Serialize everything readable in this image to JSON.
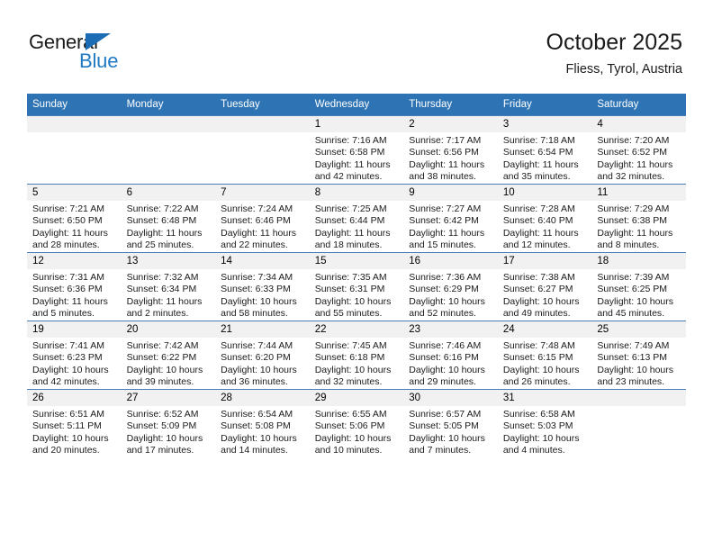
{
  "brand": {
    "line1": "General",
    "line2": "Blue",
    "triangle_color": "#1b6cb5",
    "text_color": "#1a1a1a",
    "accent_color": "#1f7ac4"
  },
  "header": {
    "title": "October 2025",
    "subtitle": "Fliess, Tyrol, Austria"
  },
  "theme": {
    "header_blue": "#2e74b5",
    "daynum_band": "#f1f1f1",
    "row_divider": "#4a7cb5",
    "text": "#1a1a1a"
  },
  "weekday_headers": [
    "Sunday",
    "Monday",
    "Tuesday",
    "Wednesday",
    "Thursday",
    "Friday",
    "Saturday"
  ],
  "weeks": [
    [
      {
        "day": "",
        "sunrise": "",
        "sunset": "",
        "daylight1": "",
        "daylight2": ""
      },
      {
        "day": "",
        "sunrise": "",
        "sunset": "",
        "daylight1": "",
        "daylight2": ""
      },
      {
        "day": "",
        "sunrise": "",
        "sunset": "",
        "daylight1": "",
        "daylight2": ""
      },
      {
        "day": "1",
        "sunrise": "Sunrise: 7:16 AM",
        "sunset": "Sunset: 6:58 PM",
        "daylight1": "Daylight: 11 hours",
        "daylight2": "and 42 minutes."
      },
      {
        "day": "2",
        "sunrise": "Sunrise: 7:17 AM",
        "sunset": "Sunset: 6:56 PM",
        "daylight1": "Daylight: 11 hours",
        "daylight2": "and 38 minutes."
      },
      {
        "day": "3",
        "sunrise": "Sunrise: 7:18 AM",
        "sunset": "Sunset: 6:54 PM",
        "daylight1": "Daylight: 11 hours",
        "daylight2": "and 35 minutes."
      },
      {
        "day": "4",
        "sunrise": "Sunrise: 7:20 AM",
        "sunset": "Sunset: 6:52 PM",
        "daylight1": "Daylight: 11 hours",
        "daylight2": "and 32 minutes."
      }
    ],
    [
      {
        "day": "5",
        "sunrise": "Sunrise: 7:21 AM",
        "sunset": "Sunset: 6:50 PM",
        "daylight1": "Daylight: 11 hours",
        "daylight2": "and 28 minutes."
      },
      {
        "day": "6",
        "sunrise": "Sunrise: 7:22 AM",
        "sunset": "Sunset: 6:48 PM",
        "daylight1": "Daylight: 11 hours",
        "daylight2": "and 25 minutes."
      },
      {
        "day": "7",
        "sunrise": "Sunrise: 7:24 AM",
        "sunset": "Sunset: 6:46 PM",
        "daylight1": "Daylight: 11 hours",
        "daylight2": "and 22 minutes."
      },
      {
        "day": "8",
        "sunrise": "Sunrise: 7:25 AM",
        "sunset": "Sunset: 6:44 PM",
        "daylight1": "Daylight: 11 hours",
        "daylight2": "and 18 minutes."
      },
      {
        "day": "9",
        "sunrise": "Sunrise: 7:27 AM",
        "sunset": "Sunset: 6:42 PM",
        "daylight1": "Daylight: 11 hours",
        "daylight2": "and 15 minutes."
      },
      {
        "day": "10",
        "sunrise": "Sunrise: 7:28 AM",
        "sunset": "Sunset: 6:40 PM",
        "daylight1": "Daylight: 11 hours",
        "daylight2": "and 12 minutes."
      },
      {
        "day": "11",
        "sunrise": "Sunrise: 7:29 AM",
        "sunset": "Sunset: 6:38 PM",
        "daylight1": "Daylight: 11 hours",
        "daylight2": "and 8 minutes."
      }
    ],
    [
      {
        "day": "12",
        "sunrise": "Sunrise: 7:31 AM",
        "sunset": "Sunset: 6:36 PM",
        "daylight1": "Daylight: 11 hours",
        "daylight2": "and 5 minutes."
      },
      {
        "day": "13",
        "sunrise": "Sunrise: 7:32 AM",
        "sunset": "Sunset: 6:34 PM",
        "daylight1": "Daylight: 11 hours",
        "daylight2": "and 2 minutes."
      },
      {
        "day": "14",
        "sunrise": "Sunrise: 7:34 AM",
        "sunset": "Sunset: 6:33 PM",
        "daylight1": "Daylight: 10 hours",
        "daylight2": "and 58 minutes."
      },
      {
        "day": "15",
        "sunrise": "Sunrise: 7:35 AM",
        "sunset": "Sunset: 6:31 PM",
        "daylight1": "Daylight: 10 hours",
        "daylight2": "and 55 minutes."
      },
      {
        "day": "16",
        "sunrise": "Sunrise: 7:36 AM",
        "sunset": "Sunset: 6:29 PM",
        "daylight1": "Daylight: 10 hours",
        "daylight2": "and 52 minutes."
      },
      {
        "day": "17",
        "sunrise": "Sunrise: 7:38 AM",
        "sunset": "Sunset: 6:27 PM",
        "daylight1": "Daylight: 10 hours",
        "daylight2": "and 49 minutes."
      },
      {
        "day": "18",
        "sunrise": "Sunrise: 7:39 AM",
        "sunset": "Sunset: 6:25 PM",
        "daylight1": "Daylight: 10 hours",
        "daylight2": "and 45 minutes."
      }
    ],
    [
      {
        "day": "19",
        "sunrise": "Sunrise: 7:41 AM",
        "sunset": "Sunset: 6:23 PM",
        "daylight1": "Daylight: 10 hours",
        "daylight2": "and 42 minutes."
      },
      {
        "day": "20",
        "sunrise": "Sunrise: 7:42 AM",
        "sunset": "Sunset: 6:22 PM",
        "daylight1": "Daylight: 10 hours",
        "daylight2": "and 39 minutes."
      },
      {
        "day": "21",
        "sunrise": "Sunrise: 7:44 AM",
        "sunset": "Sunset: 6:20 PM",
        "daylight1": "Daylight: 10 hours",
        "daylight2": "and 36 minutes."
      },
      {
        "day": "22",
        "sunrise": "Sunrise: 7:45 AM",
        "sunset": "Sunset: 6:18 PM",
        "daylight1": "Daylight: 10 hours",
        "daylight2": "and 32 minutes."
      },
      {
        "day": "23",
        "sunrise": "Sunrise: 7:46 AM",
        "sunset": "Sunset: 6:16 PM",
        "daylight1": "Daylight: 10 hours",
        "daylight2": "and 29 minutes."
      },
      {
        "day": "24",
        "sunrise": "Sunrise: 7:48 AM",
        "sunset": "Sunset: 6:15 PM",
        "daylight1": "Daylight: 10 hours",
        "daylight2": "and 26 minutes."
      },
      {
        "day": "25",
        "sunrise": "Sunrise: 7:49 AM",
        "sunset": "Sunset: 6:13 PM",
        "daylight1": "Daylight: 10 hours",
        "daylight2": "and 23 minutes."
      }
    ],
    [
      {
        "day": "26",
        "sunrise": "Sunrise: 6:51 AM",
        "sunset": "Sunset: 5:11 PM",
        "daylight1": "Daylight: 10 hours",
        "daylight2": "and 20 minutes."
      },
      {
        "day": "27",
        "sunrise": "Sunrise: 6:52 AM",
        "sunset": "Sunset: 5:09 PM",
        "daylight1": "Daylight: 10 hours",
        "daylight2": "and 17 minutes."
      },
      {
        "day": "28",
        "sunrise": "Sunrise: 6:54 AM",
        "sunset": "Sunset: 5:08 PM",
        "daylight1": "Daylight: 10 hours",
        "daylight2": "and 14 minutes."
      },
      {
        "day": "29",
        "sunrise": "Sunrise: 6:55 AM",
        "sunset": "Sunset: 5:06 PM",
        "daylight1": "Daylight: 10 hours",
        "daylight2": "and 10 minutes."
      },
      {
        "day": "30",
        "sunrise": "Sunrise: 6:57 AM",
        "sunset": "Sunset: 5:05 PM",
        "daylight1": "Daylight: 10 hours",
        "daylight2": "and 7 minutes."
      },
      {
        "day": "31",
        "sunrise": "Sunrise: 6:58 AM",
        "sunset": "Sunset: 5:03 PM",
        "daylight1": "Daylight: 10 hours",
        "daylight2": "and 4 minutes."
      },
      {
        "day": "",
        "sunrise": "",
        "sunset": "",
        "daylight1": "",
        "daylight2": ""
      }
    ]
  ]
}
